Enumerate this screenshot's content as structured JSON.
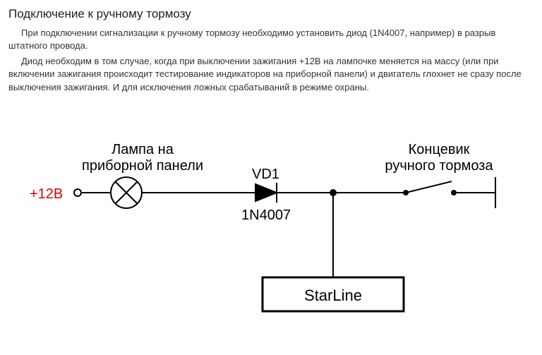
{
  "title": "Подключение к ручному тормозу",
  "para1": "При подключении сигнализации к ручному тормозу необходимо установить диод (1N4007, например) в разрыв штатного провода.",
  "para2": "Диод необходим в том случае, когда при выключении зажигания +12В на лампочке меняется на массу (или при включении зажигания происходит тестирование индикаторов на приборной панели) и двигатель глохнет не сразу после выключения зажигания. И для исключения ложных срабатываний в режиме охраны.",
  "diagram": {
    "voltage": "+12В",
    "lamp_label_l1": "Лампа на",
    "lamp_label_l2": "приборной панели",
    "diode_ref": "VD1",
    "diode_part": "1N4007",
    "switch_label_l1": "Концевик",
    "switch_label_l2": "ручного тормоза",
    "box": "StarLine"
  }
}
